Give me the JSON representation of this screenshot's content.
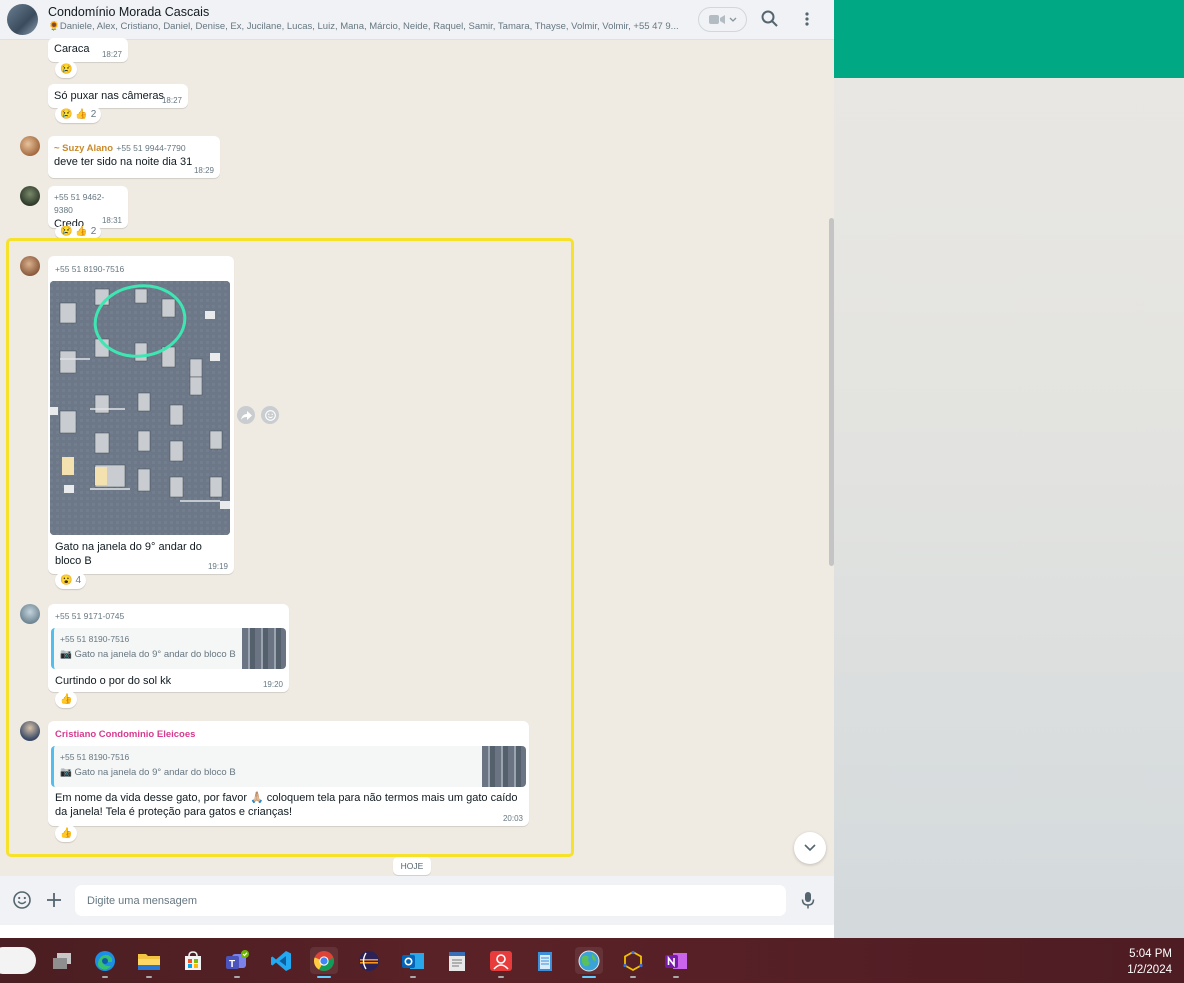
{
  "header": {
    "group_name": "Condomínio Morada Cascais",
    "members": "🌻Daniele, Alex, Cristiano, Daniel, Denise, Ex, Jucilane, Lucas, Luiz, Mana, Márcio, Neide, Raquel, Samir, Tamara, Thayse, Volmir, Volmir, +55 47 9..."
  },
  "messages": [
    {
      "text": "Caraca",
      "time": "18:27",
      "reaction_emoji": "😢",
      "reaction_count": ""
    },
    {
      "text": "Só puxar nas câmeras",
      "time": "18:27",
      "reaction_emoji": "😢 👍",
      "reaction_count": "2"
    },
    {
      "sender_name": "~ Suzy Alano",
      "sender_phone": "+55 51 9944-7790",
      "text": "deve ter sido na noite dia 31",
      "time": "18:29"
    },
    {
      "sender_phone": "+55 51 9462-9380",
      "text": "Credo",
      "time": "18:31",
      "reaction_emoji": "😢 👍",
      "reaction_count": "2"
    },
    {
      "sender_phone": "+55 51 8190-7516",
      "text": "Gato na janela do 9° andar do bloco B",
      "time": "19:19",
      "reaction_emoji": "😮",
      "reaction_count": "4"
    },
    {
      "sender_phone": "+55 51 9171-0745",
      "quote_phone": "+55 51 8190-7516",
      "quote_text": "📷 Gato na janela do 9° andar do bloco B",
      "text": "Curtindo o por do sol kk",
      "time": "19:20",
      "reaction_emoji": "👍",
      "reaction_count": ""
    },
    {
      "sender_name": "Cristiano Condominio Eleicoes",
      "quote_phone": "+55 51 8190-7516",
      "quote_text": "📷 Gato na janela do 9° andar do bloco B",
      "text": "Em nome da vida desse gato, por favor 🙏🏼 coloquem tela para não termos mais um gato caído da janela! Tela é proteção para gatos e crianças!",
      "time": "20:03",
      "reaction_emoji": "👍",
      "reaction_count": ""
    }
  ],
  "date_divider": "HOJE",
  "composer": {
    "placeholder": "Digite uma mensagem"
  },
  "clock": {
    "time": "5:04 PM",
    "date": "1/2/2024"
  },
  "colors": {
    "accent_green": "#00a884",
    "chat_background": "#efeae2",
    "highlight_border": "#f6e12b",
    "sender_suzy": "#c98a2b",
    "sender_cristiano": "#d63b8f",
    "taskbar": "#5a2227"
  },
  "taskbar_icons": [
    "start-icon",
    "task-view-icon",
    "edge-icon",
    "file-explorer-icon",
    "store-icon",
    "teams-icon",
    "vscode-icon",
    "chrome-icon",
    "eclipse-icon",
    "outlook-icon",
    "text-editor-icon",
    "remote-support-icon",
    "notepad-icon",
    "globe-app-icon",
    "network-app-icon",
    "onenote-icon"
  ]
}
